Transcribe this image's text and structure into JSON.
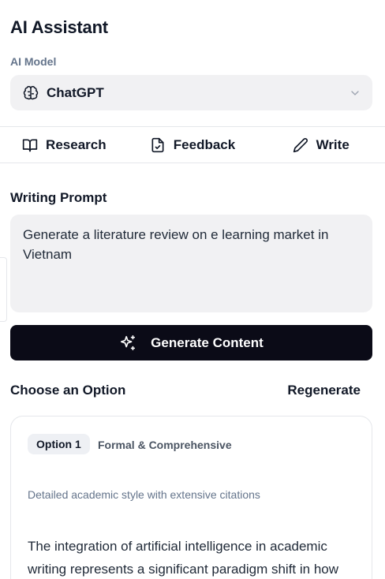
{
  "header": {
    "title": "AI Assistant"
  },
  "model": {
    "label": "AI Model",
    "selected": "ChatGPT",
    "icon": "brain-icon",
    "chevron_icon": "chevron-down-icon"
  },
  "tabs": [
    {
      "label": "Research",
      "icon": "book-open-icon"
    },
    {
      "label": "Feedback",
      "icon": "file-check-icon"
    },
    {
      "label": "Write",
      "icon": "pencil-icon"
    }
  ],
  "prompt": {
    "label": "Writing Prompt",
    "value": "Generate a literature review on e learning market in Vietnam"
  },
  "generate_button": {
    "label": "Generate Content",
    "icon": "sparkles-icon"
  },
  "options": {
    "heading": "Choose an Option",
    "regenerate_label": "Regenerate",
    "items": [
      {
        "badge": "Option 1",
        "style": "Formal & Comprehensive",
        "description": "Detailed academic style with extensive citations",
        "text": "The integration of artificial intelligence in academic writing represents a significant paradigm shift in how"
      }
    ]
  },
  "colors": {
    "primary_button": "#0b0b17",
    "input_bg": "#f1f1f3",
    "muted_text": "#64748b"
  }
}
